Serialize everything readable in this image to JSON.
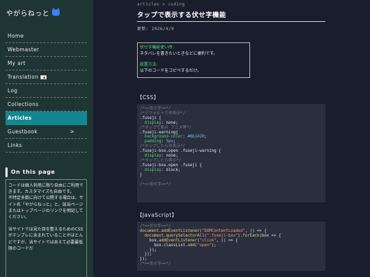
{
  "sidebar": {
    "site_title": "やがらねっと",
    "nav": [
      {
        "label": "Home"
      },
      {
        "label": "Webmaster"
      },
      {
        "label": "My art"
      },
      {
        "label": "Translation"
      },
      {
        "label": "Log"
      },
      {
        "label": "Collections"
      },
      {
        "label": "Articles"
      },
      {
        "label": "Guestbook",
        "chevron": ">"
      },
      {
        "label": "Links"
      }
    ],
    "on_this_page": {
      "heading": "On this page",
      "paragraphs": [
        "コードは個人利用に限り自由にご利用できます。カスタマイズも自由です。",
        "不特定多数に向けて公開する場合は、サイト名「やがらねっと」と、該当ページまたはトップページのリンクを明記してください。",
        "当サイトでは見た目を整えるためのCSSがテンプレに含まれていることがほとんどですが、当サイトではあえて必要最低限のコードだ"
      ]
    }
  },
  "main": {
    "breadcrumb": "articles > coding",
    "title": "タップで表示する伏せ字機能",
    "updated": "更新: 2026/4/9",
    "note": {
      "label1": "伏せ字機能使い所:",
      "text1": "ネタバレを書きたいときなどに便利です。",
      "label2": "設置方法:",
      "text2": "以下のコードをコピペするだけ。"
    },
    "css_heading": "【CSS】",
    "js_heading": "【JavaScript】",
    "css_code": [
      [
        [
          "c-cm",
          "/*==伏せ字==*/"
        ]
      ],
      [
        [
          "c-cm",
          "/*デフォルトで非表示*/"
        ]
      ],
      [
        [
          "c-sel",
          ".fuseji {"
        ]
      ],
      [
        [
          "c-prop",
          "  display"
        ],
        [
          "c-sel",
          ": none;"
        ]
      ],
      [
        [
          "c-cm",
          "/*タップで表示 アニメ等*/"
        ]
      ],
      [
        [
          "c-sel",
          ".fuseji-warning{"
        ]
      ],
      [
        [
          "c-prop",
          "  background-color"
        ],
        [
          "c-sel",
          ": "
        ],
        [
          "c-val",
          "#8b1420"
        ],
        [
          "c-sel",
          ";"
        ]
      ],
      [
        [
          "c-prop",
          "  padding"
        ],
        [
          "c-sel",
          ": "
        ],
        [
          "c-val",
          "5px"
        ],
        [
          "c-sel",
          ";"
        ]
      ],
      [
        [
          "c-cm",
          "/*タップしたら非表示*/"
        ]
      ],
      [
        [
          "c-sel",
          ".fuseji-box.open .fuseji-warning {"
        ]
      ],
      [
        [
          "c-prop",
          "  display"
        ],
        [
          "c-sel",
          ": none;"
        ]
      ],
      [
        [
          "c-cm",
          "/*タップしたら表示*/"
        ]
      ],
      [
        [
          "c-sel",
          ".fuseji-box.open .fuseji {"
        ]
      ],
      [
        [
          "c-prop",
          "  display"
        ],
        [
          "c-sel",
          ": block;"
        ]
      ],
      [
        [
          "c-sel",
          "}"
        ]
      ],
      [
        [
          "c-sel",
          ""
        ]
      ],
      [
        [
          "c-cm",
          "/*==伏せ字==*/"
        ]
      ]
    ],
    "js_code": [
      [
        [
          "c-cm",
          "/*==伏せ字==*/"
        ]
      ],
      [
        [
          "c-fn",
          "document"
        ],
        [
          "c-sel",
          "."
        ],
        [
          "c-fn",
          "addEventListener"
        ],
        [
          "c-sel",
          "("
        ],
        [
          "c-str",
          "\"DOMContentLoaded\""
        ],
        [
          "c-sel",
          ", () => {"
        ]
      ],
      [
        [
          "c-sel",
          "  "
        ],
        [
          "c-fn",
          "document"
        ],
        [
          "c-sel",
          "."
        ],
        [
          "c-fn",
          "querySelectorAll"
        ],
        [
          "c-sel",
          "("
        ],
        [
          "c-str",
          "\".fuseji-box\""
        ],
        [
          "c-sel",
          ")."
        ],
        [
          "c-fn",
          "forEach"
        ],
        [
          "c-sel",
          "(box => {"
        ]
      ],
      [
        [
          "c-sel",
          "    box."
        ],
        [
          "c-fn",
          "addEventListener"
        ],
        [
          "c-sel",
          "("
        ],
        [
          "c-str",
          "\"click\""
        ],
        [
          "c-sel",
          ", () => {"
        ]
      ],
      [
        [
          "c-sel",
          "      box.classList."
        ],
        [
          "c-fn",
          "add"
        ],
        [
          "c-sel",
          "("
        ],
        [
          "c-str",
          "\"open\""
        ],
        [
          "c-sel",
          ");"
        ]
      ],
      [
        [
          "c-sel",
          "    });"
        ]
      ],
      [
        [
          "c-sel",
          "  });"
        ]
      ],
      [
        [
          "c-sel",
          "});"
        ]
      ],
      [
        [
          "c-cm",
          "/*==伏せ字==*/"
        ]
      ]
    ]
  }
}
